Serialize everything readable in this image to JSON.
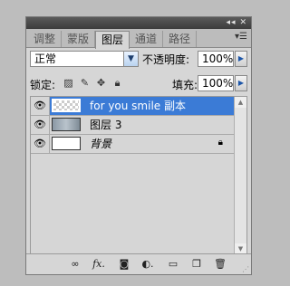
{
  "panel": {
    "collapse_icon": "double-chevron-right-icon",
    "close_icon": "close-icon",
    "menu_icon": "panel-menu-icon"
  },
  "tabs": [
    {
      "label": "调整",
      "active": false
    },
    {
      "label": "蒙版",
      "active": false
    },
    {
      "label": "图层",
      "active": true
    },
    {
      "label": "通道",
      "active": false
    },
    {
      "label": "路径",
      "active": false
    }
  ],
  "blend_mode": {
    "value": "正常"
  },
  "opacity": {
    "label": "不透明度:",
    "value": "100%"
  },
  "lock": {
    "label": "锁定:"
  },
  "fill": {
    "label": "填充:",
    "value": "100%"
  },
  "layers": [
    {
      "name": "for you smile 副本",
      "selected": true,
      "visible": true,
      "thumb": "checker",
      "italic": false,
      "locked": false
    },
    {
      "name": "图层 3",
      "selected": false,
      "visible": true,
      "thumb": "photo",
      "italic": false,
      "locked": false
    },
    {
      "name": "背景",
      "selected": false,
      "visible": true,
      "thumb": "white",
      "italic": true,
      "locked": true
    }
  ],
  "footer_icons": [
    "link-layers-icon",
    "fx-icon",
    "layer-mask-icon",
    "adjustment-layer-icon",
    "group-folder-icon",
    "new-layer-icon",
    "delete-icon"
  ]
}
